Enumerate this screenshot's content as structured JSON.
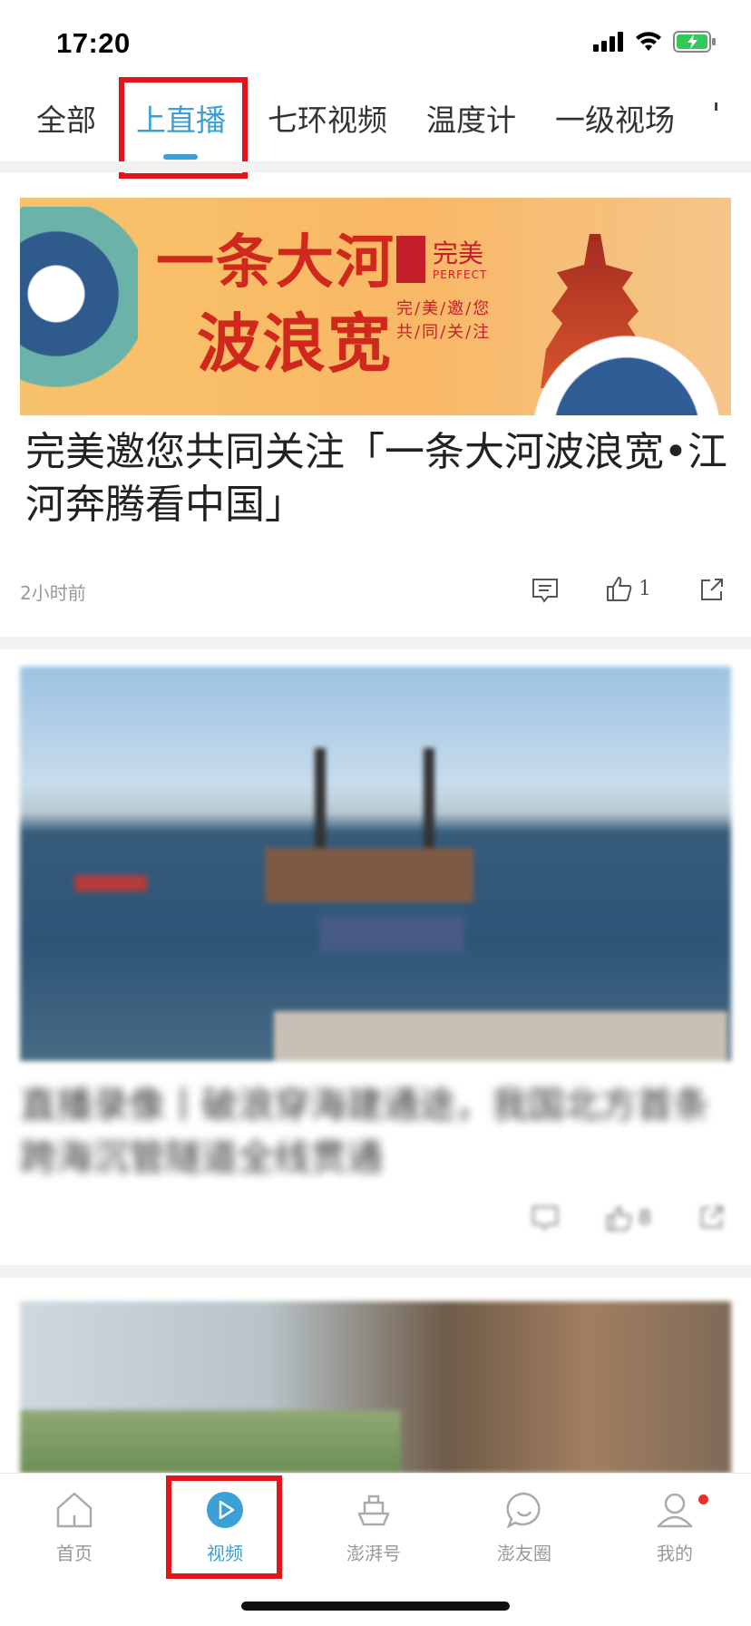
{
  "status_bar": {
    "time": "17:20"
  },
  "tabs": [
    {
      "label": "全部",
      "active": false
    },
    {
      "label": "上直播",
      "active": true
    },
    {
      "label": "七环视频",
      "active": false
    },
    {
      "label": "温度计",
      "active": false
    },
    {
      "label": "一级视场",
      "active": false
    }
  ],
  "accent_color": "#3aa0d6",
  "highlight_color": "#e3141c",
  "feed": [
    {
      "banner": {
        "headline_line1": "一条大河",
        "headline_line2": "波浪宽",
        "brand_cn": "完美",
        "brand_en": "PERFECT",
        "slogan_line1": "完/美/邀/您",
        "slogan_line2": "共/同/关/注"
      },
      "title": "完美邀您共同关注「一条大河波浪宽•江河奔腾看中国」",
      "time_ago": "2小时前",
      "like_count": "1"
    },
    {
      "title": "直播录像丨破浪穿海建通途，我国北方首条跨海沉管隧道全线贯通",
      "like_count": "8"
    }
  ],
  "bottom_nav": [
    {
      "label": "首页",
      "icon": "home-icon",
      "active": false
    },
    {
      "label": "视频",
      "icon": "video-play-icon",
      "active": true
    },
    {
      "label": "澎湃号",
      "icon": "ship-icon",
      "active": false
    },
    {
      "label": "澎友圈",
      "icon": "chat-bubble-icon",
      "active": false
    },
    {
      "label": "我的",
      "icon": "profile-icon",
      "active": false,
      "notification_dot": true
    }
  ]
}
